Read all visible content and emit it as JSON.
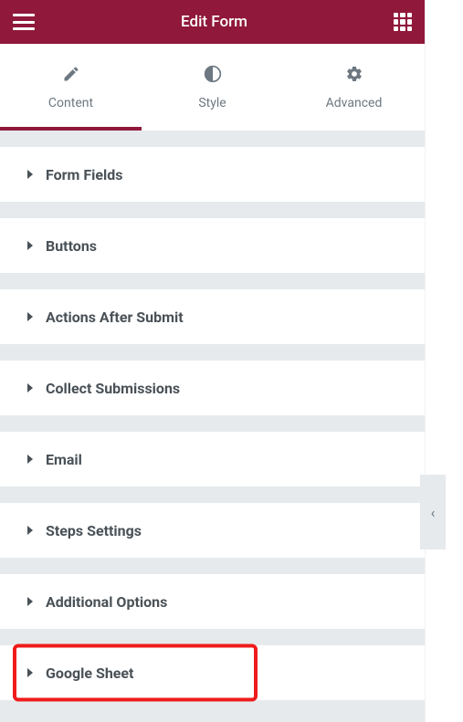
{
  "header": {
    "title": "Edit Form"
  },
  "tabs": {
    "content": "Content",
    "style": "Style",
    "advanced": "Advanced",
    "active": "content"
  },
  "sections": [
    {
      "label": "Form Fields",
      "key": "form-fields",
      "highlight": false
    },
    {
      "label": "Buttons",
      "key": "buttons",
      "highlight": false
    },
    {
      "label": "Actions After Submit",
      "key": "actions-after-submit",
      "highlight": false
    },
    {
      "label": "Collect Submissions",
      "key": "collect-submissions",
      "highlight": false
    },
    {
      "label": "Email",
      "key": "email",
      "highlight": false
    },
    {
      "label": "Steps Settings",
      "key": "steps-settings",
      "highlight": false
    },
    {
      "label": "Additional Options",
      "key": "additional-options",
      "highlight": false
    },
    {
      "label": "Google Sheet",
      "key": "google-sheet",
      "highlight": true
    }
  ],
  "side_handle": {
    "glyph": "‹"
  }
}
